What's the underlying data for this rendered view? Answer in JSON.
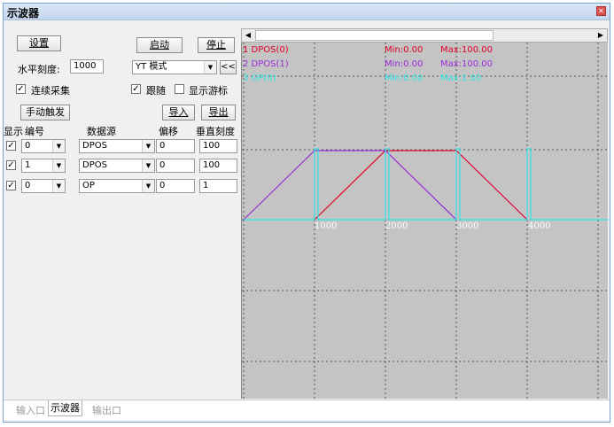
{
  "window": {
    "title": "示波器"
  },
  "toolbar": {
    "settings_label": "设置",
    "start_label": "启动",
    "stop_label": "停止",
    "hscale_label": "水平刻度:",
    "hscale_value": "1000",
    "mode_value": "YT 模式",
    "collapse_label": "<<",
    "continuous_label": "连续采集",
    "continuous_checked": true,
    "follow_label": "跟随",
    "follow_checked": true,
    "cursor_label": "显示游标",
    "cursor_checked": false,
    "manual_trigger_label": "手动触发",
    "import_label": "导入",
    "export_label": "导出"
  },
  "channels_table": {
    "headers": {
      "show": "显示",
      "id": "编号",
      "source": "数据源",
      "offset": "偏移",
      "vscale": "垂直刻度"
    },
    "rows": [
      {
        "show": true,
        "id": "0",
        "source": "DPOS",
        "offset": "0",
        "vscale": "100"
      },
      {
        "show": true,
        "id": "1",
        "source": "DPOS",
        "offset": "0",
        "vscale": "100"
      },
      {
        "show": true,
        "id": "0",
        "source": "OP",
        "offset": "0",
        "vscale": "1"
      }
    ]
  },
  "scope": {
    "legend": [
      {
        "name": "1 DPOS(0)",
        "min": "Min:0.00",
        "max": "Max:100.00",
        "color": "#e0002a"
      },
      {
        "name": "2 DPOS(1)",
        "min": "Min:0.00",
        "max": "Max:100.00",
        "color": "#9a2bd8"
      },
      {
        "name": "3 OP(0)",
        "min": "Min:0.00",
        "max": "Max:1.00",
        "color": "#2ee6e6"
      }
    ],
    "x_ticks": [
      "1000",
      "2000",
      "3000",
      "4000"
    ],
    "bg_color": "#c4c4c4"
  },
  "chart_data": {
    "type": "line",
    "x_ticks": [
      1000,
      2000,
      3000,
      4000
    ],
    "series": [
      {
        "name": "1 DPOS(0)",
        "color": "#e0002a",
        "x": [
          1000,
          2000,
          3000,
          4000
        ],
        "y": [
          0,
          100,
          100,
          0
        ]
      },
      {
        "name": "2 DPOS(1)",
        "color": "#9a2bd8",
        "x": [
          0,
          1000,
          2000,
          3000
        ],
        "y": [
          0,
          100,
          100,
          0
        ]
      },
      {
        "name": "3 OP(0)",
        "color": "#2ee6e6",
        "x": [
          0,
          1000,
          1000,
          1050,
          1050,
          2000,
          2000,
          2050,
          2050,
          3000,
          3000,
          3050,
          3050,
          4000,
          4000,
          4050,
          4050
        ],
        "y": [
          0,
          0,
          1,
          1,
          0,
          0,
          1,
          1,
          0,
          0,
          1,
          1,
          0,
          0,
          1,
          1,
          0
        ]
      }
    ]
  },
  "tabs": [
    "输入口",
    "示波器",
    "输出口"
  ],
  "active_tab": "示波器"
}
